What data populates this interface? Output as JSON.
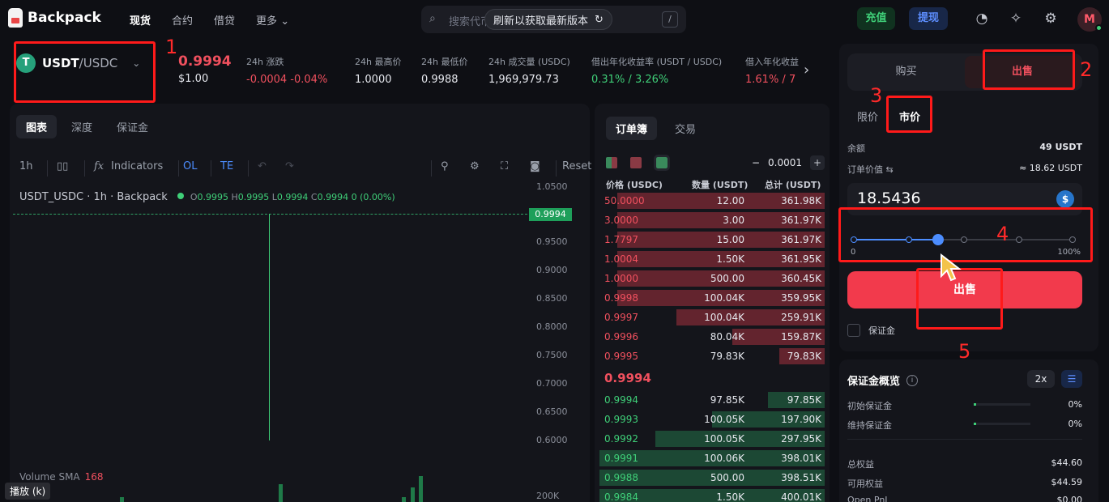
{
  "app": {
    "logo_text": "Backpack",
    "nav": [
      "现货",
      "合约",
      "借贷",
      "更多"
    ],
    "search_placeholder": "搜索代币",
    "refresh_label": "刷新以获取最新版本",
    "search_shortcut": "/",
    "deposit_label": "充值",
    "withdraw_label": "提现",
    "avatar_letter": "M"
  },
  "market": {
    "pair_base": "USDT",
    "pair_quote": "/USDC",
    "last_price": "0.9994",
    "last_price_usd": "$1.00",
    "stats": [
      {
        "label": "24h 涨跌",
        "value": "-0.0004  -0.04%",
        "tone": "red"
      },
      {
        "label": "24h 最高价",
        "value": "1.0000",
        "tone": ""
      },
      {
        "label": "24h 最低价",
        "value": "0.9988",
        "tone": ""
      },
      {
        "label": "24h 成交量 (USDC)",
        "value": "1,969,979.73",
        "tone": ""
      },
      {
        "label": "借出年化收益率 (USDT / USDC)",
        "value": "0.31% / 3.26%",
        "tone": "green"
      },
      {
        "label": "借入年化收益",
        "value": "1.61% / 7",
        "tone": "red"
      }
    ]
  },
  "chart": {
    "tabs": [
      "图表",
      "深度",
      "保证金"
    ],
    "toolbar": {
      "interval": "1h",
      "indicators": "Indicators",
      "ol": "OL",
      "te": "TE",
      "reset": "Reset"
    },
    "legend_title": "USDT_USDC · 1h · Backpack",
    "ohlc": {
      "o": "0.9995",
      "h": "0.9995",
      "l": "0.9994",
      "c": "0.9994",
      "change": "0 (0.00%)"
    },
    "price_tag": "0.9994",
    "y_ticks": [
      "1.0500",
      "0.9500",
      "0.9000",
      "0.8500",
      "0.8000",
      "0.7500",
      "0.7000",
      "0.6500",
      "0.6000",
      "200K"
    ],
    "volume_label": "Volume SMA",
    "volume_value": "168"
  },
  "orderbook": {
    "tabs": [
      "订单簿",
      "交易"
    ],
    "step": "0.0001",
    "headers": [
      "价格 (USDC)",
      "数量 (USDT)",
      "总计 (USDT)"
    ],
    "asks": [
      {
        "p": "50.0000",
        "q": "12.00",
        "t": "361.98K",
        "depth": 0.92
      },
      {
        "p": "3.0000",
        "q": "3.00",
        "t": "361.97K",
        "depth": 0.92
      },
      {
        "p": "1.7797",
        "q": "15.00",
        "t": "361.97K",
        "depth": 0.92
      },
      {
        "p": "1.0004",
        "q": "1.50K",
        "t": "361.95K",
        "depth": 0.92
      },
      {
        "p": "1.0000",
        "q": "500.00",
        "t": "360.45K",
        "depth": 0.92
      },
      {
        "p": "0.9998",
        "q": "100.04K",
        "t": "359.95K",
        "depth": 0.92
      },
      {
        "p": "0.9997",
        "q": "100.04K",
        "t": "259.91K",
        "depth": 0.66
      },
      {
        "p": "0.9996",
        "q": "80.04K",
        "t": "159.87K",
        "depth": 0.41
      },
      {
        "p": "0.9995",
        "q": "79.83K",
        "t": "79.83K",
        "depth": 0.2
      }
    ],
    "mid": "0.9994",
    "bids": [
      {
        "p": "0.9994",
        "q": "97.85K",
        "t": "97.85K",
        "depth": 0.25
      },
      {
        "p": "0.9993",
        "q": "100.05K",
        "t": "197.90K",
        "depth": 0.5
      },
      {
        "p": "0.9992",
        "q": "100.05K",
        "t": "297.95K",
        "depth": 0.75
      },
      {
        "p": "0.9991",
        "q": "100.06K",
        "t": "398.01K",
        "depth": 1.0
      },
      {
        "p": "0.9988",
        "q": "500.00",
        "t": "398.51K",
        "depth": 1.0
      },
      {
        "p": "0.9984",
        "q": "1.50K",
        "t": "400.01K",
        "depth": 1.0
      }
    ]
  },
  "trade": {
    "buy_label": "购买",
    "sell_label": "出售",
    "order_types": [
      "限价",
      "市价"
    ],
    "balance_label": "余额",
    "balance_value": "49 USDT",
    "order_value_label": "订单价值",
    "order_value": "≈ 18.62 USDT",
    "amount": "18.5436",
    "slider_min": "0",
    "slider_max": "100%",
    "slider_value": 0.4,
    "submit_label": "出售",
    "margin_label": "保证金"
  },
  "margin_overview": {
    "title": "保证金概览",
    "leverage": "2x",
    "rows": [
      {
        "label": "初始保证金",
        "value": "0%"
      },
      {
        "label": "维持保证金",
        "value": "0%"
      }
    ],
    "equity": [
      {
        "label": "总权益",
        "value": "$44.60"
      },
      {
        "label": "可用权益",
        "value": "$44.59"
      },
      {
        "label": "Open PnL",
        "value": "$0.00"
      }
    ]
  },
  "annotations": [
    "1",
    "2",
    "3",
    "4",
    "5"
  ],
  "overlay": {
    "playback": "播放 (k)"
  },
  "colors": {
    "accent_red": "#f23a4c",
    "accent_green": "#3fcf78",
    "accent_blue": "#4c8dff",
    "annotation": "#ff1a1a"
  }
}
